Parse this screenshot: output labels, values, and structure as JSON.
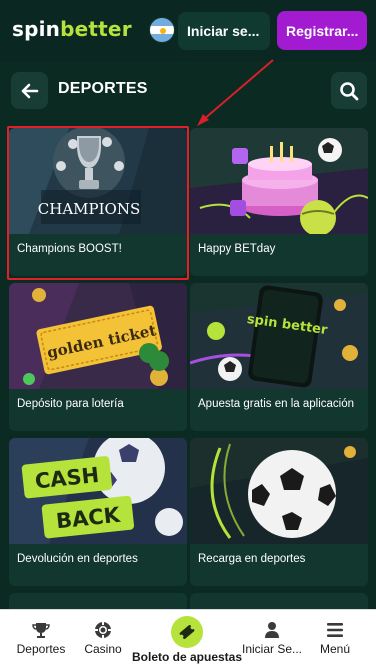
{
  "header": {
    "logo_part1": "spin",
    "logo_part2": "better",
    "flag": "argentina-flag",
    "login_label": "Iniciar se...",
    "register_label": "Registrar..."
  },
  "section": {
    "title": "DEPORTES",
    "back_icon": "arrow-left-icon",
    "search_icon": "search-icon"
  },
  "promos": [
    {
      "label": "Champions BOOST!",
      "banner_text": "CHAMPIONS"
    },
    {
      "label": "Happy BETday"
    },
    {
      "label": "Depósito para lotería",
      "banner_text": "golden ticket"
    },
    {
      "label": "Apuesta gratis en la aplicación",
      "banner_text": "spin better"
    },
    {
      "label": "Devolución en deportes",
      "banner_text_1": "CASH",
      "banner_text_2": "BACK"
    },
    {
      "label": "Recarga en deportes"
    }
  ],
  "bottom_nav": [
    {
      "label": "Deportes",
      "icon": "trophy-icon"
    },
    {
      "label": "Casino",
      "icon": "chip-icon"
    },
    {
      "label": "Boleto de apuestas",
      "icon": "ticket-icon"
    },
    {
      "label": "Iniciar Se...",
      "icon": "user-icon"
    },
    {
      "label": "Menú",
      "icon": "menu-icon"
    }
  ],
  "colors": {
    "background": "#0b2a22",
    "accent_green": "#b6e33b",
    "register_purple": "#a31bd0",
    "highlight_red": "#e1202a"
  }
}
